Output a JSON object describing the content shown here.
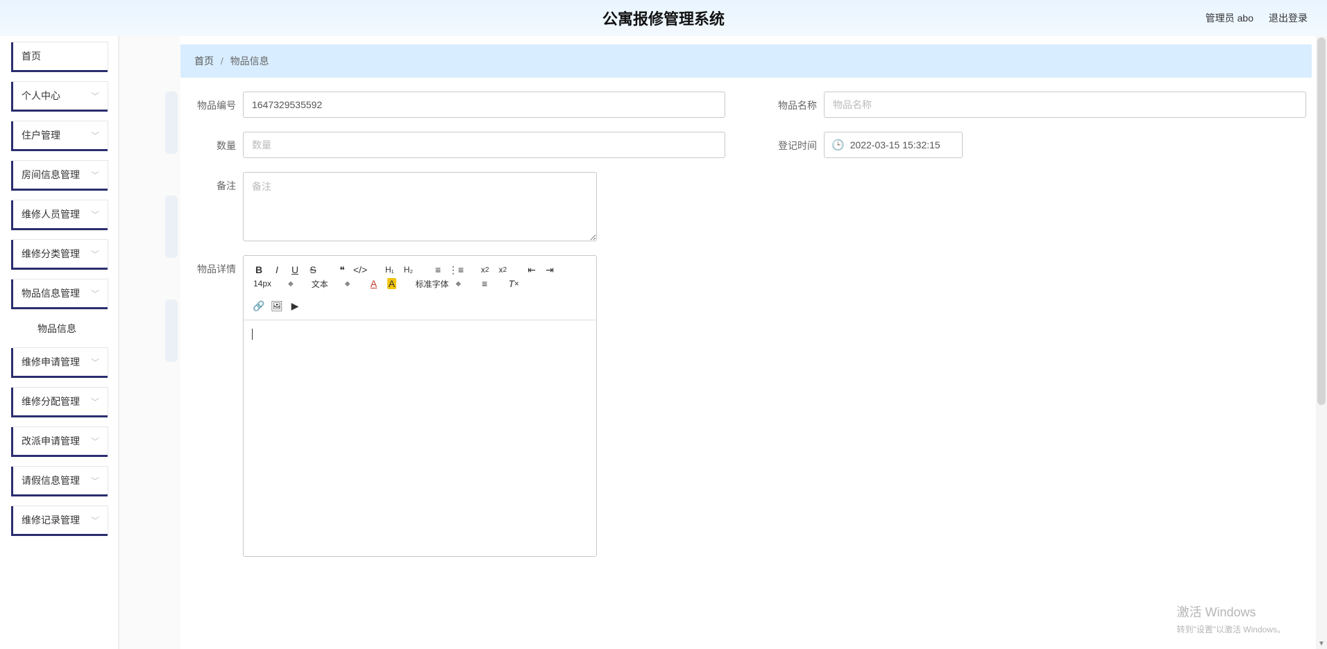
{
  "header": {
    "title": "公寓报修管理系统",
    "admin_label": "管理员 abo",
    "logout_label": "退出登录"
  },
  "sidebar": {
    "items": [
      {
        "label": "首页",
        "expandable": false
      },
      {
        "label": "个人中心",
        "expandable": true
      },
      {
        "label": "住户管理",
        "expandable": true
      },
      {
        "label": "房间信息管理",
        "expandable": true
      },
      {
        "label": "维修人员管理",
        "expandable": true
      },
      {
        "label": "维修分类管理",
        "expandable": true
      },
      {
        "label": "物品信息管理",
        "expandable": true,
        "sub": [
          {
            "label": "物品信息"
          }
        ]
      },
      {
        "label": "维修申请管理",
        "expandable": true
      },
      {
        "label": "维修分配管理",
        "expandable": true
      },
      {
        "label": "改派申请管理",
        "expandable": true
      },
      {
        "label": "请假信息管理",
        "expandable": true
      },
      {
        "label": "维修记录管理",
        "expandable": true
      }
    ]
  },
  "breadcrumb": {
    "home": "首页",
    "sep": "/",
    "current": "物品信息"
  },
  "form": {
    "item_code_label": "物品编号",
    "item_code_value": "1647329535592",
    "item_name_label": "物品名称",
    "item_name_placeholder": "物品名称",
    "quantity_label": "数量",
    "quantity_placeholder": "数量",
    "register_time_label": "登记时间",
    "register_time_value": "2022-03-15 15:32:15",
    "remark_label": "备注",
    "remark_placeholder": "备注",
    "detail_label": "物品详情"
  },
  "editor": {
    "font_size": "14px",
    "block_type": "文本",
    "font_family": "标准字体",
    "h1": "H₁",
    "h2": "H₂"
  },
  "watermark": {
    "title": "激活 Windows",
    "sub": "转到\"设置\"以激活 Windows。"
  }
}
